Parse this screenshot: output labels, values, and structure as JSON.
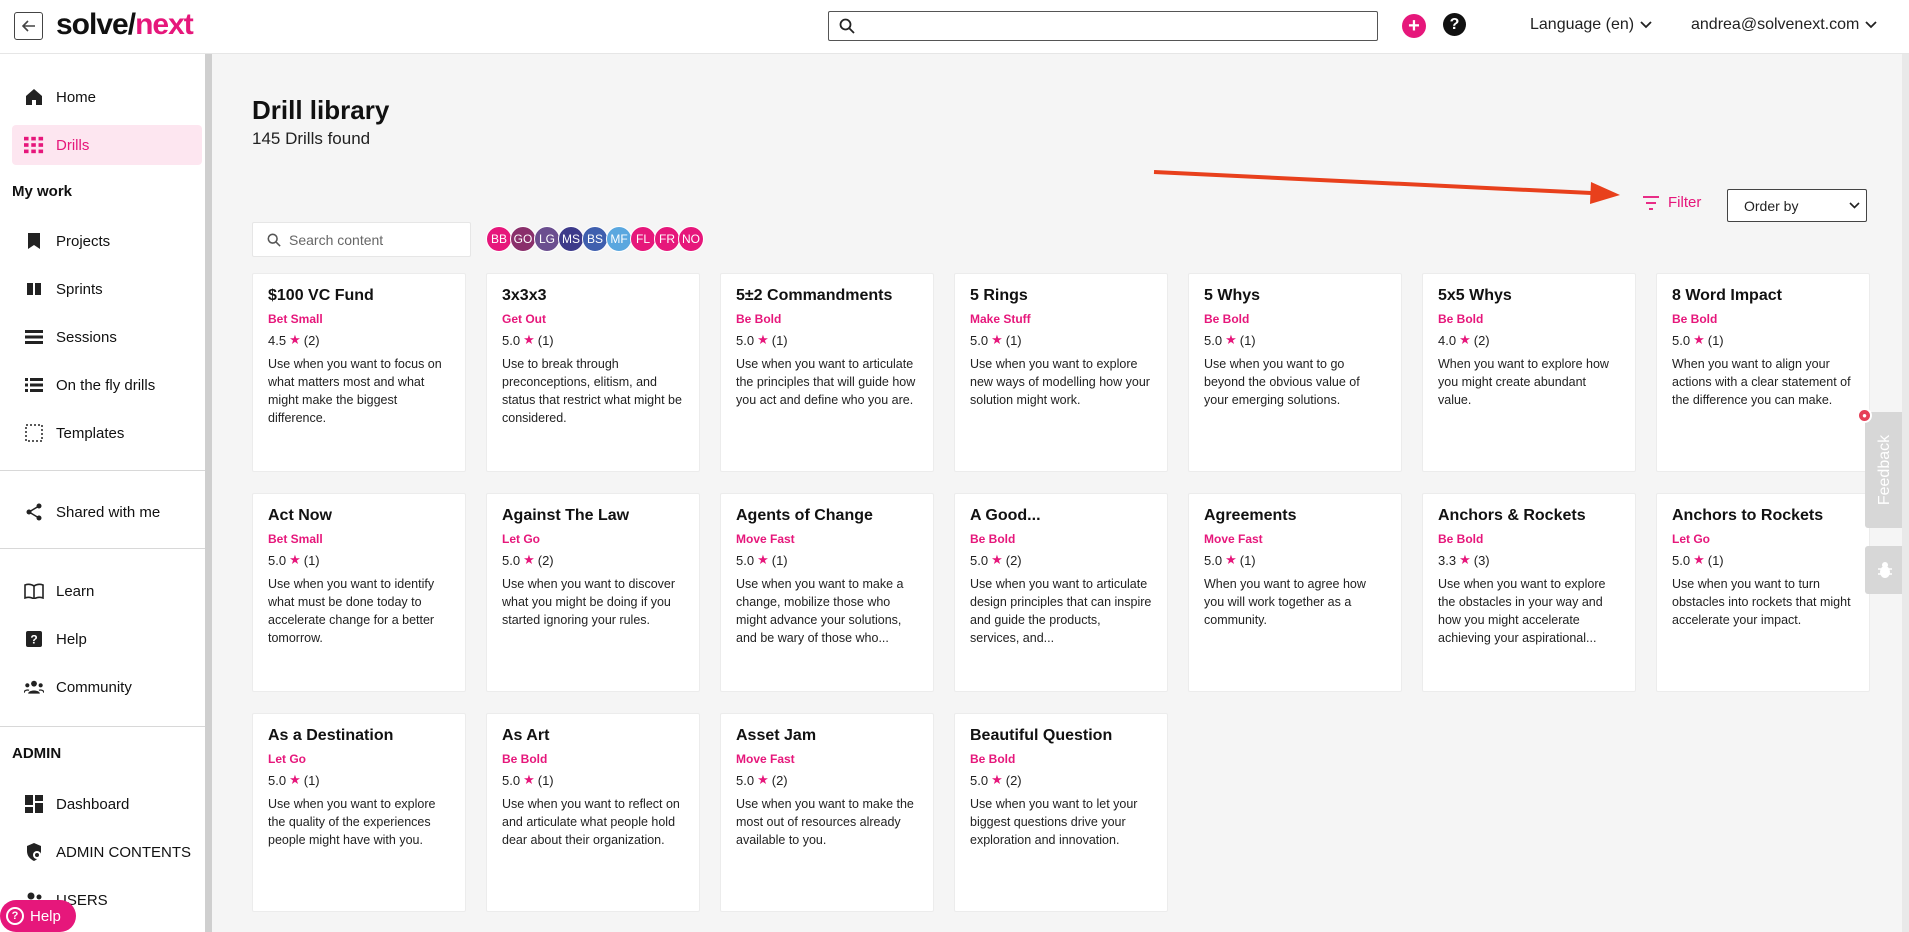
{
  "header": {
    "logo_part1": "solve/",
    "logo_part2": "next",
    "search_placeholder": "",
    "language_label": "Language (en)",
    "user_email": "andrea@solvenext.com",
    "add_symbol": "+",
    "help_symbol": "?"
  },
  "sidebar": {
    "items_top": [
      {
        "label": "Home",
        "icon": "home-icon"
      },
      {
        "label": "Drills",
        "icon": "grid-icon",
        "active": true
      }
    ],
    "my_work_title": "My work",
    "my_work_items": [
      {
        "label": "Projects",
        "icon": "bookmark-icon"
      },
      {
        "label": "Sprints",
        "icon": "columns-icon"
      },
      {
        "label": "Sessions",
        "icon": "list-icon"
      },
      {
        "label": "On the fly drills",
        "icon": "list-detail-icon"
      },
      {
        "label": "Templates",
        "icon": "dashed-square-icon"
      }
    ],
    "shared_label": "Shared with me",
    "support_items": [
      {
        "label": "Learn",
        "icon": "book-icon"
      },
      {
        "label": "Help",
        "icon": "question-icon"
      },
      {
        "label": "Community",
        "icon": "people-icon"
      }
    ],
    "admin_title": "ADMIN",
    "admin_items": [
      {
        "label": "Dashboard",
        "icon": "dashboard-icon"
      },
      {
        "label": "ADMIN CONTENTS",
        "icon": "admin-gear-icon"
      },
      {
        "label": "USERS",
        "icon": "users-icon"
      }
    ],
    "help_pill_label": "Help"
  },
  "main": {
    "title": "Drill library",
    "count_text": "145 Drills found",
    "filter_label": "Filter",
    "order_by_label": "Order by",
    "search_placeholder": "Search content",
    "avatars": [
      {
        "initials": "BB",
        "color": "#e6177b"
      },
      {
        "initials": "GO",
        "color": "#8a2f6b"
      },
      {
        "initials": "LG",
        "color": "#6b4e8f"
      },
      {
        "initials": "MS",
        "color": "#3d3a8a"
      },
      {
        "initials": "BS",
        "color": "#3f5fae"
      },
      {
        "initials": "MF",
        "color": "#5aa7df"
      },
      {
        "initials": "FL",
        "color": "#e6177b"
      },
      {
        "initials": "FR",
        "color": "#e6177b"
      },
      {
        "initials": "NO",
        "color": "#e6177b"
      }
    ],
    "cards": [
      {
        "title": "$100 VC Fund",
        "category": "Bet Small",
        "rating": "4.5",
        "count": "(2)",
        "desc": "Use when you want to focus on what matters most and what might make the biggest difference."
      },
      {
        "title": "3x3x3",
        "category": "Get Out",
        "rating": "5.0",
        "count": "(1)",
        "desc": "Use to break through preconceptions, elitism, and status that restrict what might be considered."
      },
      {
        "title": "5±2 Commandments",
        "category": "Be Bold",
        "rating": "5.0",
        "count": "(1)",
        "desc": "Use when you want to articulate the principles that will guide how you act and define who you are."
      },
      {
        "title": "5 Rings",
        "category": "Make Stuff",
        "rating": "5.0",
        "count": "(1)",
        "desc": "Use when you want to explore new ways of modelling how your solution might work."
      },
      {
        "title": "5 Whys",
        "category": "Be Bold",
        "rating": "5.0",
        "count": "(1)",
        "desc": "Use when you want to go beyond the obvious value of your emerging solutions."
      },
      {
        "title": "5x5 Whys",
        "category": "Be Bold",
        "rating": "4.0",
        "count": "(2)",
        "desc": "When you want to explore how you might create abundant value."
      },
      {
        "title": "8 Word Impact",
        "category": "Be Bold",
        "rating": "5.0",
        "count": "(1)",
        "desc": "When you want to align your actions with a clear statement of the difference you can make."
      },
      {
        "title": "Act Now",
        "category": "Bet Small",
        "rating": "5.0",
        "count": "(1)",
        "desc": "Use when you want to identify what must be done today to accelerate change for a better tomorrow."
      },
      {
        "title": "Against The Law",
        "category": "Let Go",
        "rating": "5.0",
        "count": "(2)",
        "desc": "Use when you want to discover what you might be doing if you started ignoring your rules."
      },
      {
        "title": "Agents of Change",
        "category": "Move Fast",
        "rating": "5.0",
        "count": "(1)",
        "desc": "Use when you want to make a change, mobilize those who might advance your solutions, and be wary of those who..."
      },
      {
        "title": "A Good...",
        "category": "Be Bold",
        "rating": "5.0",
        "count": "(2)",
        "desc": "Use when you want to articulate design principles that can inspire and guide the products, services, and..."
      },
      {
        "title": "Agreements",
        "category": "Move Fast",
        "rating": "5.0",
        "count": "(1)",
        "desc": "When you want to agree how you will work together as a community."
      },
      {
        "title": "Anchors & Rockets",
        "category": "Be Bold",
        "rating": "3.3",
        "count": "(3)",
        "desc": "Use when you want to explore the obstacles in your way and how you might accelerate achieving your aspirational..."
      },
      {
        "title": "Anchors to Rockets",
        "category": "Let Go",
        "rating": "5.0",
        "count": "(1)",
        "desc": "Use when you want to turn obstacles into rockets that might accelerate your impact."
      },
      {
        "title": "As a Destination",
        "category": "Let Go",
        "rating": "5.0",
        "count": "(1)",
        "desc": "Use when you want to explore the quality of the experiences people might have with you."
      },
      {
        "title": "As Art",
        "category": "Be Bold",
        "rating": "5.0",
        "count": "(1)",
        "desc": "Use when you want to reflect on and articulate what people hold dear about their organization."
      },
      {
        "title": "Asset Jam",
        "category": "Move Fast",
        "rating": "5.0",
        "count": "(2)",
        "desc": "Use when you want to make the most out of resources already available to you."
      },
      {
        "title": "Beautiful Question",
        "category": "Be Bold",
        "rating": "5.0",
        "count": "(2)",
        "desc": "Use when you want to let your biggest questions drive your exploration and innovation."
      }
    ]
  },
  "feedback": {
    "label": "Feedback"
  },
  "colors": {
    "accent": "#e6177b",
    "arrow": "#e8401c"
  }
}
